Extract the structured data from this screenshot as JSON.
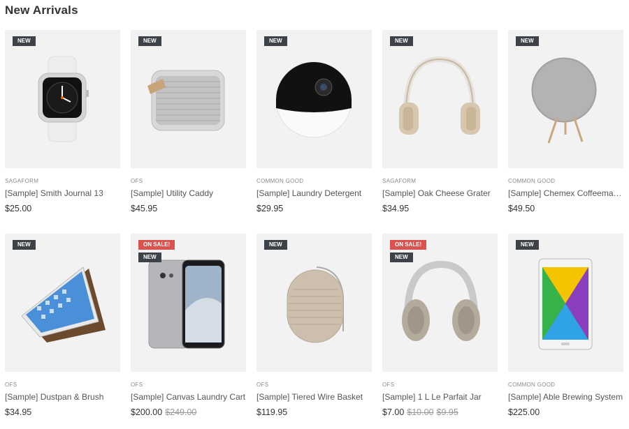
{
  "section_title": "New Arrivals",
  "colors": {
    "new_badge": "#3d4249",
    "sale_badge": "#d9534f",
    "card_bg": "#f2f2f2"
  },
  "products": [
    {
      "brand": "SAGAFORM",
      "name": "[Sample] Smith Journal 13",
      "price": "$25.00",
      "badges": [
        "NEW"
      ],
      "icon": "smartwatch-image"
    },
    {
      "brand": "OFS",
      "name": "[Sample] Utility Caddy",
      "price": "$45.95",
      "badges": [
        "NEW"
      ],
      "icon": "speaker-image"
    },
    {
      "brand": "COMMON GOOD",
      "name": "[Sample] Laundry Detergent",
      "price": "$29.95",
      "badges": [
        "NEW"
      ],
      "icon": "camera-image"
    },
    {
      "brand": "SAGAFORM",
      "name": "[Sample] Oak Cheese Grater",
      "price": "$34.95",
      "badges": [
        "NEW"
      ],
      "icon": "headphones-image"
    },
    {
      "brand": "COMMON GOOD",
      "name": "[Sample] Chemex Coffeemake...",
      "price": "$49.50",
      "badges": [
        "NEW"
      ],
      "icon": "round-speaker-image"
    },
    {
      "brand": "OFS",
      "name": "[Sample] Dustpan & Brush",
      "price": "$34.95",
      "badges": [
        "NEW"
      ],
      "icon": "tablet-image"
    },
    {
      "brand": "OFS",
      "name": "[Sample] Canvas Laundry Cart",
      "price": "$200.00",
      "old_price": "$249.00",
      "badges": [
        "ON SALE!",
        "NEW"
      ],
      "icon": "phone-image"
    },
    {
      "brand": "OFS",
      "name": "[Sample] Tiered Wire Basket",
      "price": "$119.95",
      "badges": [
        "NEW"
      ],
      "icon": "portable-speaker-image"
    },
    {
      "brand": "OFS",
      "name": "[Sample] 1 L Le Parfait Jar",
      "price": "$7.00",
      "old_price": "$10.00",
      "old_price2": "$9.95",
      "badges": [
        "ON SALE!",
        "NEW"
      ],
      "icon": "headphones-image"
    },
    {
      "brand": "COMMON GOOD",
      "name": "[Sample] Able Brewing System",
      "price": "$225.00",
      "badges": [
        "NEW"
      ],
      "icon": "tablet-image"
    }
  ]
}
